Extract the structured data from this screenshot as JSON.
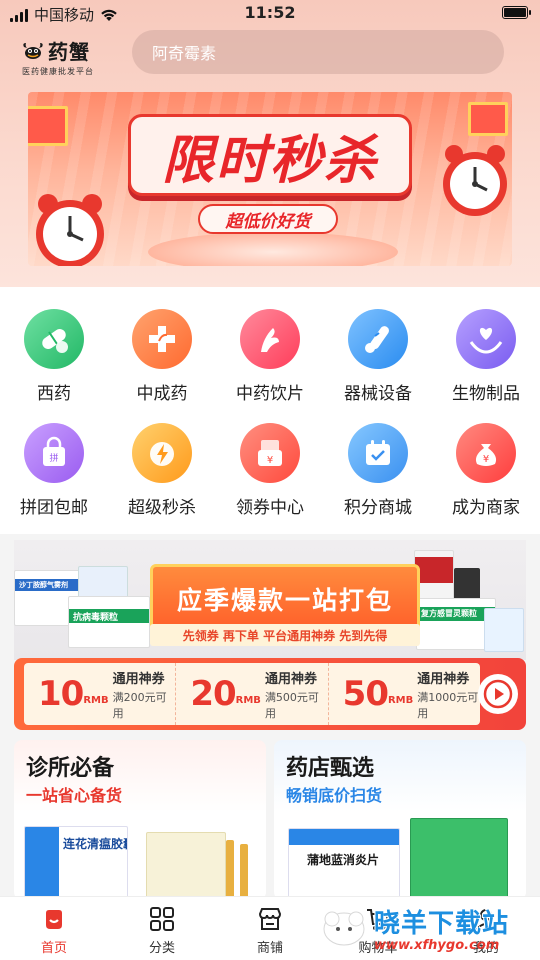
{
  "status_bar": {
    "carrier": "中国移动",
    "time": "11:52"
  },
  "header": {
    "logo_name": "药蟹",
    "logo_tagline": "医药健康批发平台",
    "search_placeholder": "阿奇霉素"
  },
  "banner": {
    "title": "限时秒杀",
    "subtitle": "超低价好货"
  },
  "categories": [
    {
      "label": "西药",
      "icon": "pill-icon",
      "color": "#3cc07a"
    },
    {
      "label": "中成药",
      "icon": "medical-cross-icon",
      "color": "#ff7a45"
    },
    {
      "label": "中药饮片",
      "icon": "herb-icon",
      "color": "#ff4d6a"
    },
    {
      "label": "器械设备",
      "icon": "thermometer-icon",
      "color": "#3c9ef5"
    },
    {
      "label": "生物制品",
      "icon": "heart-hand-icon",
      "color": "#8a6cf2"
    },
    {
      "label": "拼团包邮",
      "icon": "shopping-bag-icon",
      "color": "#a46cf2"
    },
    {
      "label": "超级秒杀",
      "icon": "lightning-clock-icon",
      "color": "#ffa41b"
    },
    {
      "label": "领券中心",
      "icon": "coupon-icon",
      "color": "#ff5a4d"
    },
    {
      "label": "积分商城",
      "icon": "calendar-check-icon",
      "color": "#3c9ef5"
    },
    {
      "label": "成为商家",
      "icon": "money-bag-icon",
      "color": "#ff4d4d"
    }
  ],
  "promo": {
    "headline": "应季爆款一站打包",
    "strip": "先领券 再下单 平台通用神券 先到先得",
    "box_labels": [
      "沙丁胺醇气雾剂",
      "抗病毒颗粒",
      "复方感冒灵颗粒"
    ],
    "coupons": [
      {
        "amount": "10",
        "unit": "RMB",
        "name": "通用神券",
        "condition": "满200元可用"
      },
      {
        "amount": "20",
        "unit": "RMB",
        "name": "通用神券",
        "condition": "满500元可用"
      },
      {
        "amount": "50",
        "unit": "RMB",
        "name": "通用神券",
        "condition": "满1000元可用"
      }
    ]
  },
  "cards": [
    {
      "title": "诊所必备",
      "subtitle": "一站省心备货",
      "subtitle_color": "#e8382e",
      "product": "连花清瘟胶囊"
    },
    {
      "title": "药店甄选",
      "subtitle": "畅销底价扫货",
      "subtitle_color": "#2a86e6",
      "product": "蒲地蓝消炎片"
    }
  ],
  "tabbar": [
    {
      "label": "首页",
      "icon": "home-icon",
      "active": true
    },
    {
      "label": "分类",
      "icon": "grid-icon",
      "active": false
    },
    {
      "label": "商铺",
      "icon": "store-icon",
      "active": false
    },
    {
      "label": "购物车",
      "icon": "cart-icon",
      "active": false
    },
    {
      "label": "我的",
      "icon": "profile-icon",
      "active": false
    }
  ],
  "watermark": {
    "text": "晓羊下载站",
    "url": "www.xfhygo.com"
  },
  "colors": {
    "brand_red": "#e8382e",
    "accent_blue": "#1d8fe0"
  }
}
